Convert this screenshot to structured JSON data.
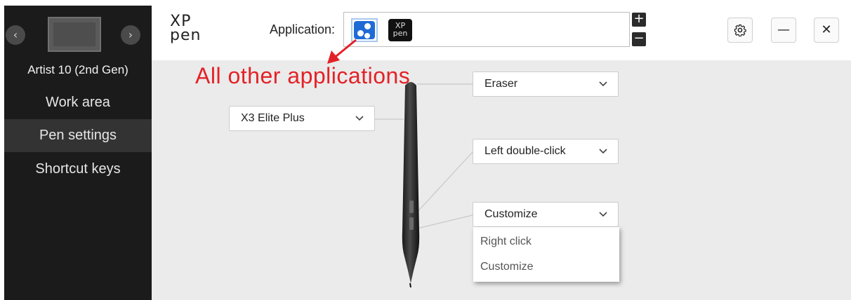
{
  "sidebar": {
    "device_name": "Artist 10 (2nd Gen)",
    "prev_icon": "chevron-left-icon",
    "next_icon": "chevron-right-icon",
    "items": [
      {
        "label": "Work area",
        "active": false
      },
      {
        "label": "Pen settings",
        "active": true
      },
      {
        "label": "Shortcut keys",
        "active": false
      }
    ]
  },
  "header": {
    "logo_line1": "XP",
    "logo_line2": "pen",
    "application_label": "Application:",
    "apps": [
      {
        "icon": "all-applications-icon"
      },
      {
        "icon": "xppen-app-icon",
        "text_line1": "XP",
        "text_line2": "pen"
      }
    ],
    "add_symbol": "+",
    "remove_symbol": "−",
    "settings_icon": "gear-icon",
    "minimize_symbol": "—",
    "close_symbol": "✕"
  },
  "annotation": {
    "text": "All other applications",
    "color": "#e32227"
  },
  "pen": {
    "model_selected": "X3 Elite Plus",
    "top_button_selected": "Eraser",
    "upper_button_selected": "Left double-click",
    "lower_button_selected": "Customize",
    "lower_button_options": [
      "Right click",
      "Customize"
    ]
  },
  "colors": {
    "sidebar_bg": "#1b1b1b",
    "sidebar_active": "#333333",
    "content_bg": "#ebebeb",
    "accent_blue": "#1f6bd6",
    "annotation_red": "#e32227"
  }
}
